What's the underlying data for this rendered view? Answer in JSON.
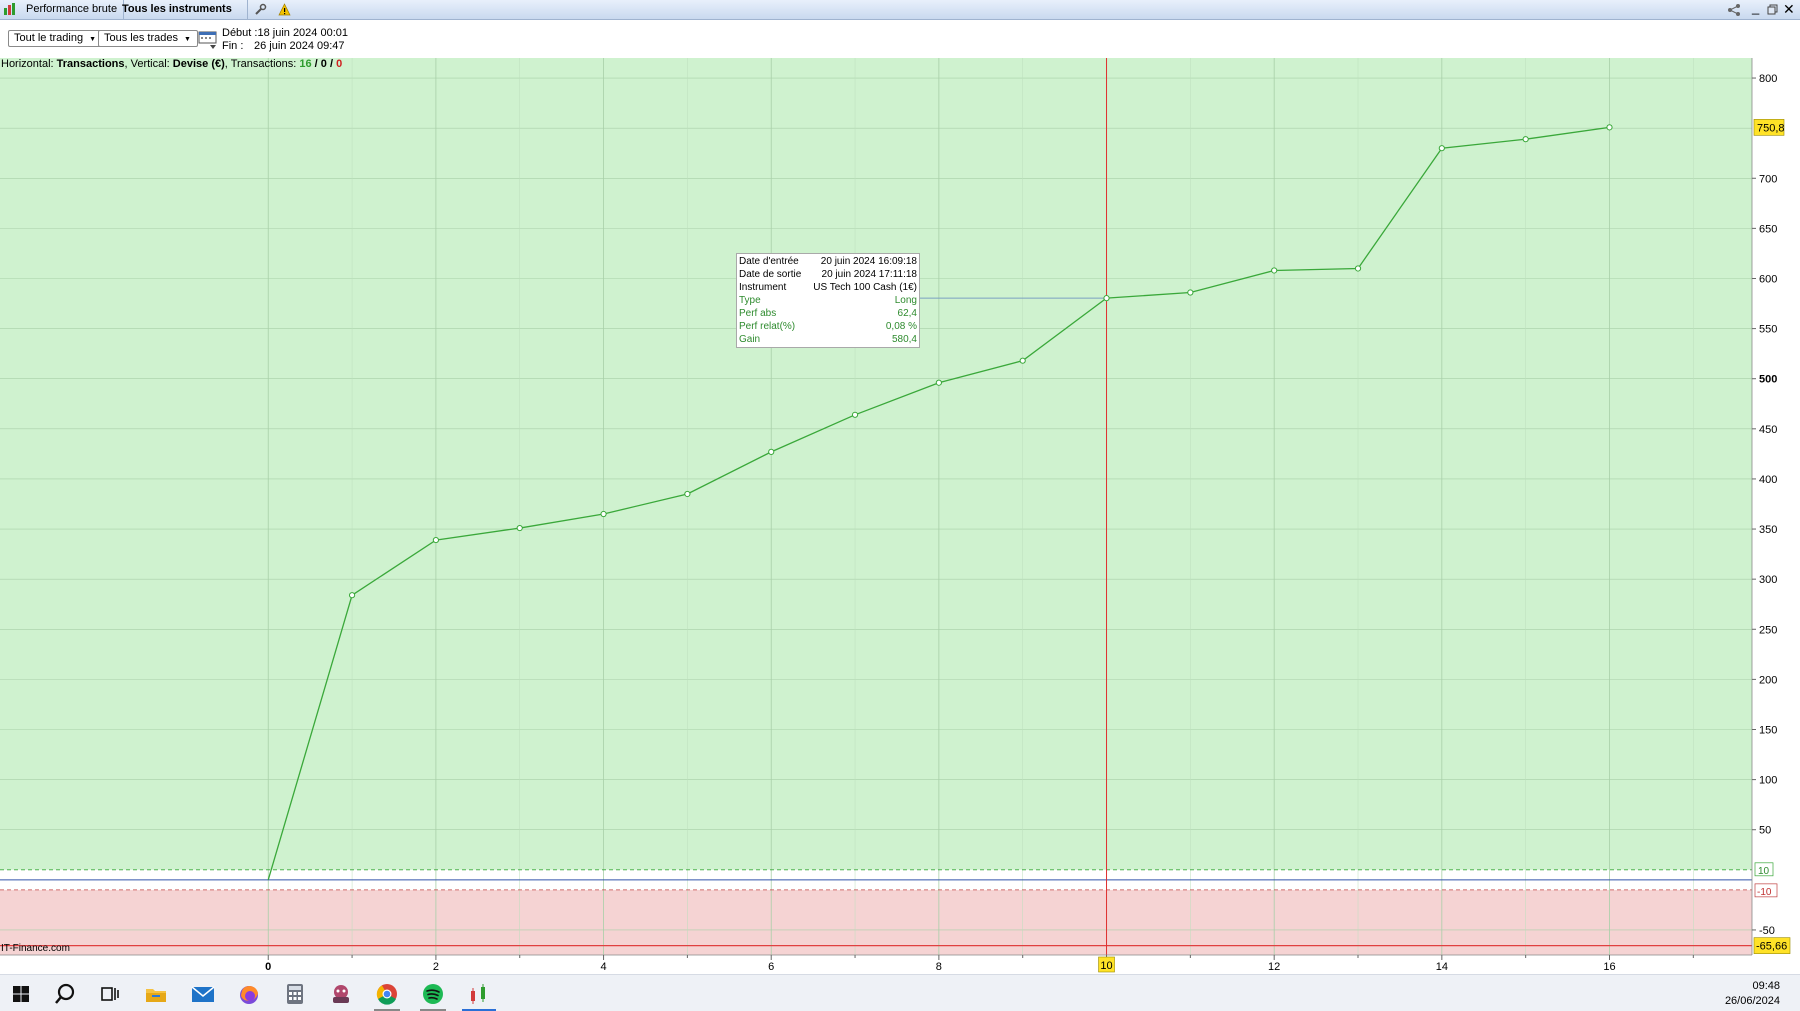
{
  "titlebar": {
    "tab1": "Performance brute",
    "tab2": "Tous les instruments"
  },
  "toolbar": {
    "filter1": "Tout le trading",
    "filter2": "Tous les trades",
    "debut_label": "Début :",
    "debut_value": "18 juin 2024 00:01",
    "fin_label": "Fin :",
    "fin_value": "26 juin 2024 09:47"
  },
  "info": {
    "horizontal_label": "Horizontal: ",
    "horizontal_value": "Transactions",
    "vertical_label": ", Vertical: ",
    "vertical_value": "Devise (€)",
    "tx_label": ", Transactions: ",
    "tx_win": "16",
    "tx_sep1": " / ",
    "tx_neutral": "0",
    "tx_sep2": " / ",
    "tx_loss": "0"
  },
  "tooltip": {
    "rows": [
      {
        "k": "Date d'entrée",
        "v": "20 juin 2024 16:09:18"
      },
      {
        "k": "Date de sortie",
        "v": "20 juin 2024 17:11:18"
      },
      {
        "k": "Instrument",
        "v": "US Tech 100 Cash (1€)"
      },
      {
        "k": "Type",
        "v": "Long"
      },
      {
        "k": "Perf abs",
        "v": "62,4"
      },
      {
        "k": "Perf relat(%)",
        "v": "0,08 %"
      },
      {
        "k": "Gain",
        "v": "580,4"
      }
    ]
  },
  "watermark": "IT-Finance.com",
  "taskbar": {
    "time": "09:48",
    "date": "26/06/2024"
  },
  "colors": {
    "profit_zone": "#cff2cf",
    "loss_zone": "#f5d3d3",
    "line": "#3aa83a",
    "cursor": "#e03030",
    "badge": "#ffe227"
  },
  "chart_data": {
    "type": "line",
    "x": [
      0,
      1,
      2,
      3,
      4,
      5,
      6,
      7,
      8,
      9,
      10,
      11,
      12,
      13,
      14,
      15,
      16
    ],
    "values": [
      0,
      284,
      339,
      351,
      365,
      385,
      427,
      464,
      496,
      518,
      580.4,
      586,
      608,
      610,
      730,
      739,
      750.8
    ],
    "xlim": [
      -3.2,
      17.7
    ],
    "ylim": [
      -75,
      820
    ],
    "xticks": [
      0,
      2,
      4,
      6,
      8,
      10,
      12,
      14,
      16
    ],
    "yticks": [
      800,
      700,
      650,
      600,
      550,
      500,
      450,
      400,
      350,
      300,
      250,
      200,
      150,
      100,
      50,
      -50
    ],
    "bold_yticks": [
      500
    ],
    "bands": {
      "upper": 10,
      "lower": -10,
      "min": -65.66
    },
    "band_labels": {
      "upper": "10",
      "lower": "-10"
    },
    "last_value_label": "750,8",
    "min_value_label": "-65,66",
    "cursor_x": 10,
    "cursor_x_label": "10",
    "grid": true
  }
}
